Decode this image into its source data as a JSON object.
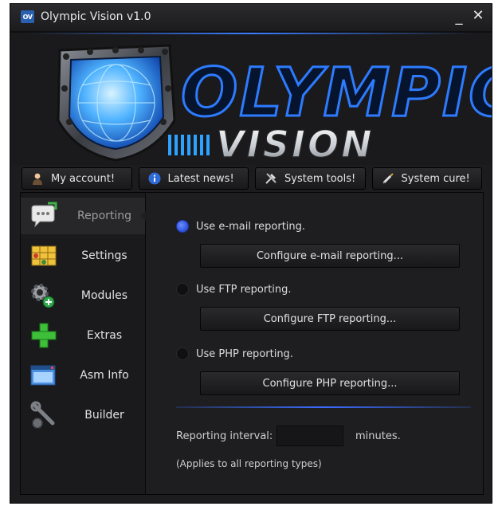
{
  "window": {
    "icon_text": "OV",
    "title": "Olympic Vision v1.0",
    "minimize_glyph": "_",
    "close_glyph": "✕"
  },
  "banner": {
    "logo_line1": "OLYMPIC",
    "logo_line2": "VISION",
    "shield_icon": "globe-shield-icon",
    "accent_color": "#2f6bff"
  },
  "nav": [
    {
      "label": "My account!",
      "icon": "user-icon"
    },
    {
      "label": "Latest news!",
      "icon": "info-icon"
    },
    {
      "label": "System tools!",
      "icon": "tools-icon"
    },
    {
      "label": "System cure!",
      "icon": "syringe-icon"
    }
  ],
  "sidebar": {
    "items": [
      {
        "label": "Reporting",
        "icon": "chat-bubble-icon",
        "active": true
      },
      {
        "label": "Settings",
        "icon": "grid-settings-icon",
        "active": false
      },
      {
        "label": "Modules",
        "icon": "gear-add-icon",
        "active": false
      },
      {
        "label": "Extras",
        "icon": "plus-icon",
        "active": false
      },
      {
        "label": "Asm Info",
        "icon": "window-icon",
        "active": false
      },
      {
        "label": "Builder",
        "icon": "wrench-gear-icon",
        "active": false
      }
    ]
  },
  "reporting": {
    "options": [
      {
        "label": "Use e-mail reporting.",
        "button": "Configure e-mail reporting...",
        "selected": true
      },
      {
        "label": "Use FTP reporting.",
        "button": "Configure FTP reporting...",
        "selected": false
      },
      {
        "label": "Use PHP reporting.",
        "button": "Configure PHP reporting...",
        "selected": false
      }
    ],
    "interval_label": "Reporting interval:",
    "interval_value": "",
    "interval_unit": "minutes.",
    "note": "(Applies to all reporting types)"
  }
}
